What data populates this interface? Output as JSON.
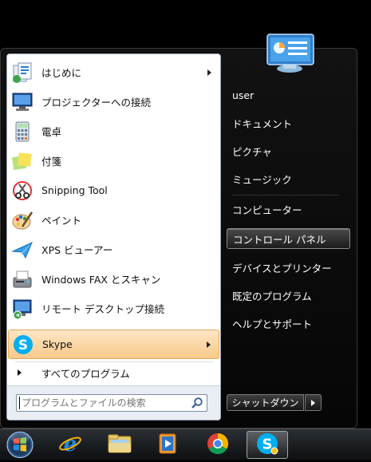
{
  "programs": [
    {
      "label": "はじめに",
      "icon": "getting-started-icon",
      "submenu": true
    },
    {
      "label": "プロジェクターへの接続",
      "icon": "projector-icon",
      "submenu": false
    },
    {
      "label": "電卓",
      "icon": "calculator-icon",
      "submenu": false
    },
    {
      "label": "付箋",
      "icon": "sticky-notes-icon",
      "submenu": false
    },
    {
      "label": "Snipping Tool",
      "icon": "snipping-tool-icon",
      "submenu": false
    },
    {
      "label": "ペイント",
      "icon": "paint-icon",
      "submenu": false
    },
    {
      "label": "XPS ビューアー",
      "icon": "xps-viewer-icon",
      "submenu": false
    },
    {
      "label": "Windows FAX とスキャン",
      "icon": "fax-scan-icon",
      "submenu": false
    },
    {
      "label": "リモート デスクトップ接続",
      "icon": "remote-desktop-icon",
      "submenu": false
    },
    {
      "label": "Skype",
      "icon": "skype-icon",
      "submenu": true,
      "highlighted": true
    }
  ],
  "all_programs_label": "すべてのプログラム",
  "search": {
    "placeholder": "プログラムとファイルの検索"
  },
  "right_pane": {
    "user": "user",
    "documents": "ドキュメント",
    "pictures": "ピクチャ",
    "music": "ミュージック",
    "computer": "コンピューター",
    "control_panel": "コントロール パネル",
    "devices_printers": "デバイスとプリンター",
    "default_programs": "既定のプログラム",
    "help_support": "ヘルプとサポート"
  },
  "shutdown_label": "シャットダウン",
  "taskbar": {
    "items": [
      "internet-explorer-icon",
      "file-explorer-icon",
      "media-player-icon",
      "chrome-icon",
      "skype-icon"
    ],
    "active": "skype-icon"
  },
  "colors": {
    "highlight": "#f9c98a",
    "skype_blue": "#00aff0",
    "menu_dark": "#0a0a0a"
  }
}
